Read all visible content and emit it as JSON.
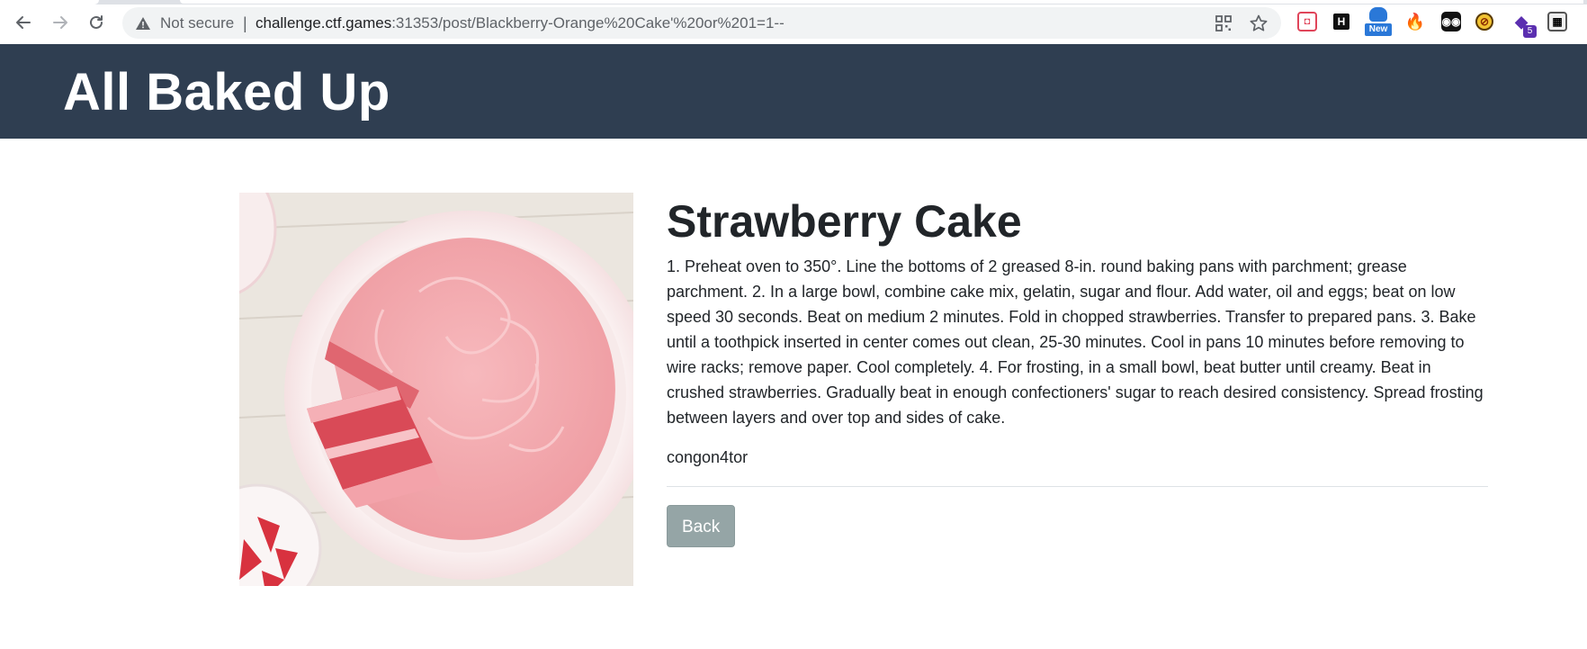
{
  "browser": {
    "security_label": "Not secure",
    "divider": "|",
    "url_host": "challenge.ctf.games",
    "url_rest": ":31353/post/Blackberry-Orange%20Cake'%20or%201=1--",
    "extensions": [
      {
        "name": "pocket-icon",
        "glyph": "◘"
      },
      {
        "name": "hashnode-icon",
        "glyph": "H"
      },
      {
        "name": "new-extension-icon",
        "badge": "New"
      },
      {
        "name": "flame-icon",
        "glyph": "🔥"
      },
      {
        "name": "mask-icon",
        "glyph": "◉◉"
      },
      {
        "name": "blocker-icon",
        "glyph": "⊘"
      },
      {
        "name": "cap-icon",
        "glyph": "◆",
        "badge": "5"
      },
      {
        "name": "grid-icon",
        "glyph": "▦"
      }
    ]
  },
  "site": {
    "title": "All Baked Up"
  },
  "post": {
    "title": "Strawberry Cake",
    "body": "1. Preheat oven to 350°. Line the bottoms of 2 greased 8-in. round baking pans with parchment; grease parchment. 2. In a large bowl, combine cake mix, gelatin, sugar and flour. Add water, oil and eggs; beat on low speed 30 seconds. Beat on medium 2 minutes. Fold in chopped strawberries. Transfer to prepared pans. 3. Bake until a toothpick inserted in center comes out clean, 25-30 minutes. Cool in pans 10 minutes before removing to wire racks; remove paper. Cool completely. 4. For frosting, in a small bowl, beat butter until creamy. Beat in crushed strawberries. Gradually beat in enough confectioners' sugar to reach desired consistency. Spread frosting between layers and over top and sides of cake.",
    "author": "congon4tor",
    "back_label": "Back"
  },
  "colors": {
    "header_bg": "#2f3e51",
    "back_button_bg": "#95a5a6",
    "text": "#212529"
  }
}
